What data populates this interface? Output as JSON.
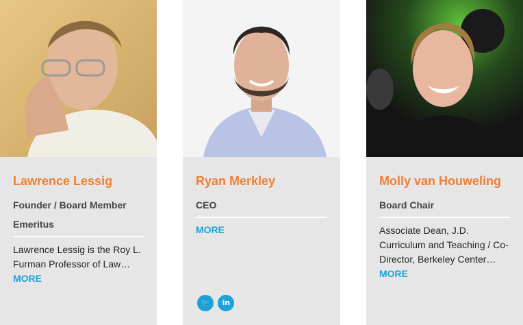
{
  "people": [
    {
      "name": "Lawrence Lessig",
      "role_lines": [
        "Founder / Board Member",
        "Emeritus"
      ],
      "bio": "Lawrence Lessig is the Roy L. Furman Professor of Law…",
      "more_label": "MORE"
    },
    {
      "name": "Ryan Merkley",
      "role_lines": [
        "CEO"
      ],
      "more_label": "MORE",
      "social": [
        {
          "icon": "twitter-icon",
          "glyph": "🐦"
        },
        {
          "icon": "linkedin-icon",
          "glyph": "in"
        }
      ]
    },
    {
      "name": "Molly van Houweling",
      "role_lines": [
        "Board Chair"
      ],
      "bio": "Associate Dean, J.D. Curriculum and Teaching / Co-Director, Berkeley Center…",
      "more_label": "MORE"
    }
  ],
  "colors": {
    "name_accent": "#ee7f34",
    "link": "#1da1d8",
    "card_bg": "#e6e6e6"
  }
}
